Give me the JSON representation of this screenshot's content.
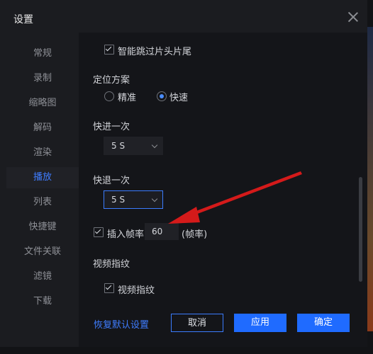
{
  "dialog": {
    "title": "设置"
  },
  "sidebar": {
    "items": [
      {
        "label": "常规"
      },
      {
        "label": "录制"
      },
      {
        "label": "缩略图"
      },
      {
        "label": "解码"
      },
      {
        "label": "渲染"
      },
      {
        "label": "播放",
        "active": true
      },
      {
        "label": "列表"
      },
      {
        "label": "快捷键"
      },
      {
        "label": "文件关联"
      },
      {
        "label": "滤镜"
      },
      {
        "label": "下载"
      }
    ]
  },
  "content": {
    "skip_intro": {
      "label": "智能跳过片头片尾",
      "checked": true
    },
    "positioning": {
      "title": "定位方案",
      "options": [
        {
          "label": "精准",
          "checked": false
        },
        {
          "label": "快速",
          "checked": true
        }
      ]
    },
    "forward": {
      "title": "快进一次",
      "value": "5 S"
    },
    "backward": {
      "title": "快退一次",
      "value": "5 S"
    },
    "insert_frame": {
      "label": "插入帧率",
      "value": "60",
      "unit": "(帧率)",
      "checked": true
    },
    "video_fingerprint": {
      "title": "视频指纹",
      "label": "视频指纹",
      "checked": true
    }
  },
  "footer": {
    "reset_label": "恢复默认设置",
    "cancel_label": "取消",
    "apply_label": "应用",
    "ok_label": "确定"
  },
  "colors": {
    "accent": "#1f6bff",
    "annotation_arrow": "#d41a1a"
  }
}
